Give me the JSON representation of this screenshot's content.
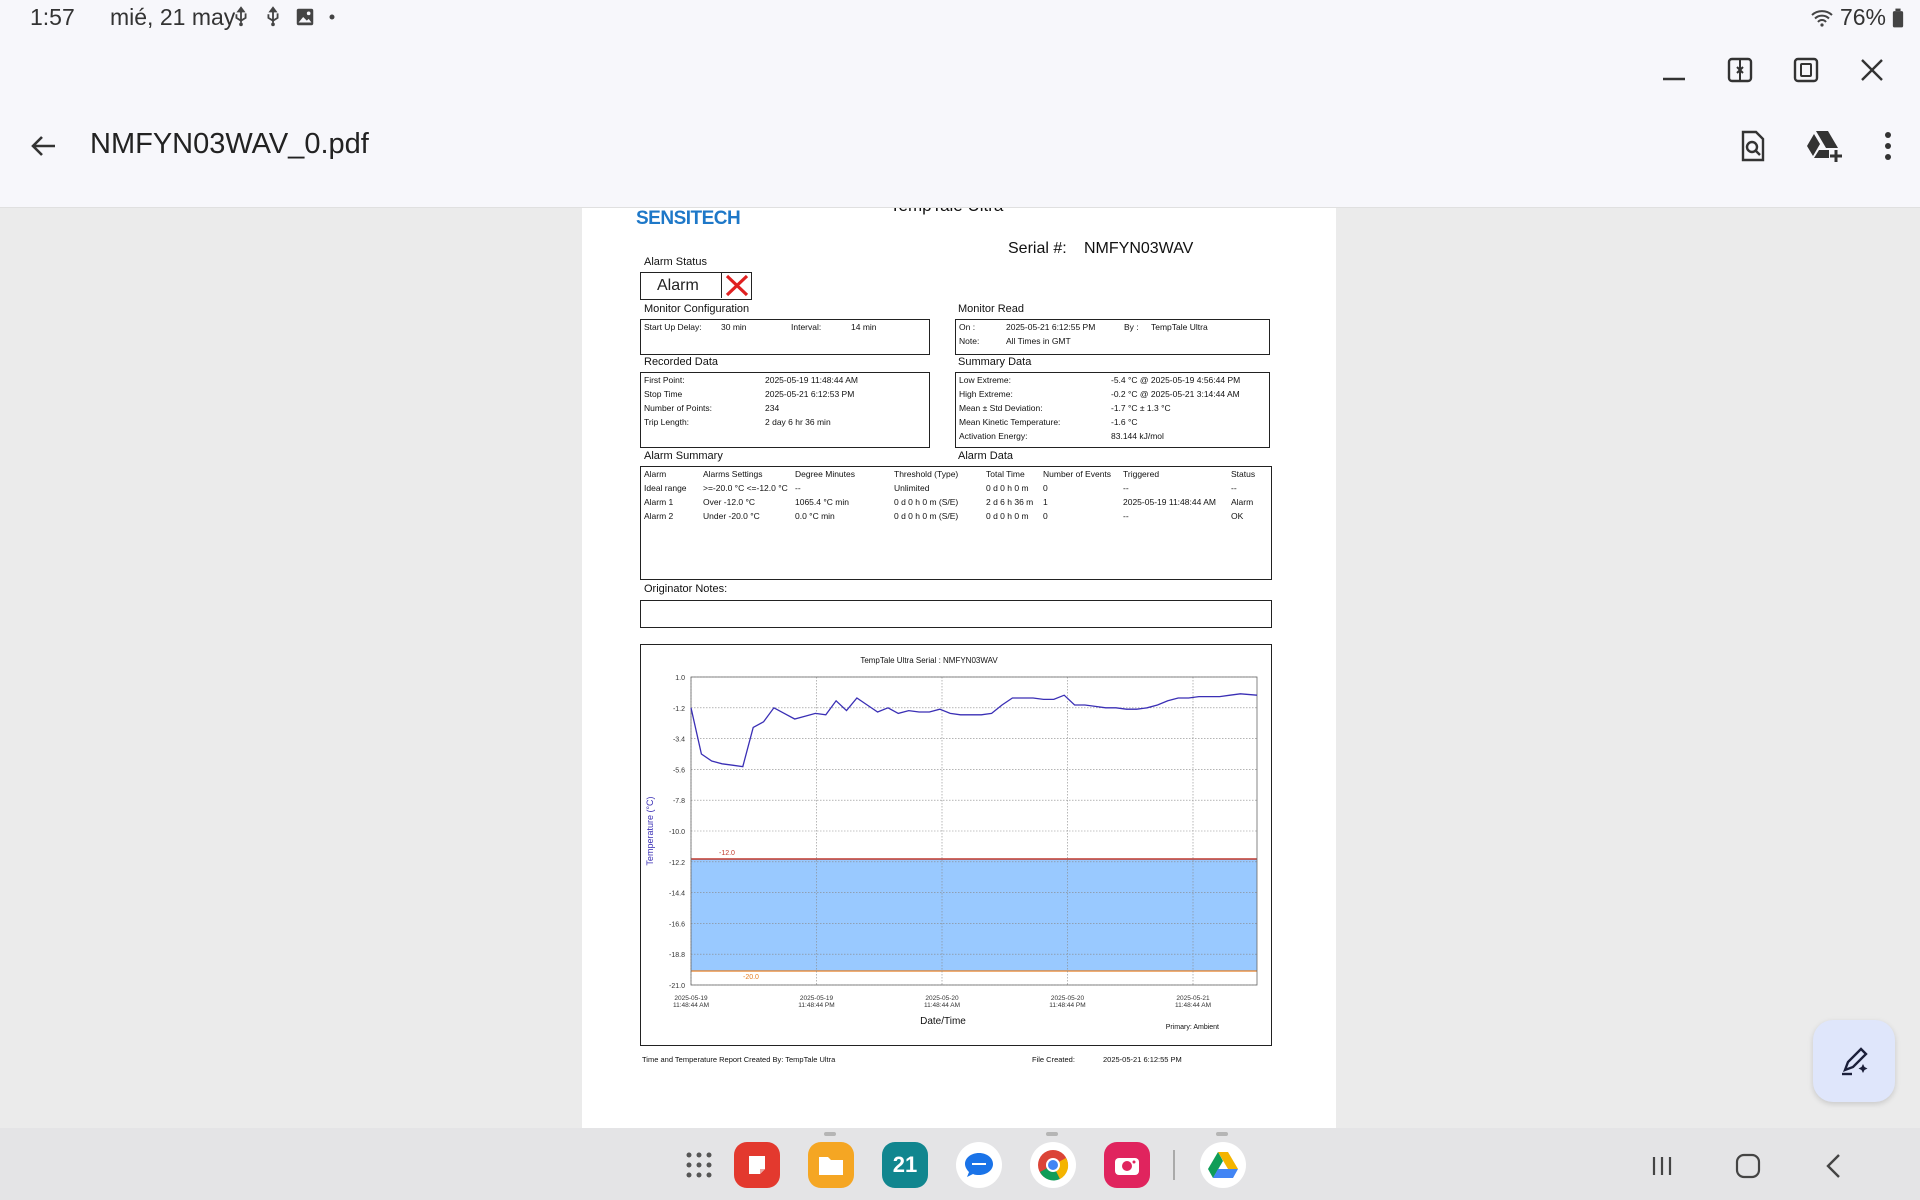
{
  "status_bar": {
    "time": "1:57",
    "date": "mié, 21 may",
    "battery": "76%"
  },
  "app_bar": {
    "title": "NMFYN03WAV_0.pdf"
  },
  "report": {
    "logo": "SENSITECH",
    "product": "TempTale Ultra",
    "serial_label": "Serial #:",
    "serial": "NMFYN03WAV",
    "alarm_status_label": "Alarm Status",
    "alarm_status": "Alarm",
    "monitor_config": {
      "title": "Monitor Configuration",
      "startup_label": "Start Up Delay:",
      "startup": "30 min",
      "interval_label": "Interval:",
      "interval": "14 min"
    },
    "monitor_read": {
      "title": "Monitor Read",
      "on_label": "On :",
      "on": "2025-05-21  6:12:55 PM",
      "by_label": "By :",
      "by": "TempTale Ultra",
      "note_label": "Note:",
      "note": "All Times in GMT"
    },
    "recorded": {
      "title": "Recorded Data",
      "rows": [
        {
          "k": "First Point:",
          "v": "2025-05-19 11:48:44 AM"
        },
        {
          "k": "Stop Time",
          "v": "2025-05-21  6:12:53 PM"
        },
        {
          "k": "Number of Points:",
          "v": "234"
        },
        {
          "k": "Trip Length:",
          "v": "2 day 6 hr 36 min"
        }
      ]
    },
    "summary": {
      "title": "Summary Data",
      "rows": [
        {
          "k": "Low Extreme:",
          "v": "-5.4 °C @ 2025-05-19  4:56:44 PM"
        },
        {
          "k": "High Extreme:",
          "v": "-0.2 °C @ 2025-05-21  3:14:44 AM"
        },
        {
          "k": "Mean ± Std Deviation:",
          "v": "-1.7 °C ± 1.3 °C"
        },
        {
          "k": "Mean Kinetic Temperature:",
          "v": "-1.6 °C"
        },
        {
          "k": "Activation Energy:",
          "v": "83.144 kJ/mol"
        }
      ]
    },
    "alarm_summary_title": "Alarm Summary",
    "alarm_data_title": "Alarm Data",
    "alarm_headers": [
      "Alarm",
      "Alarms Settings",
      "Degree Minutes",
      "Threshold (Type)",
      "Total Time",
      "Number of Events",
      "Triggered",
      "Status"
    ],
    "alarm_rows": [
      [
        "Ideal range",
        ">=-20.0 °C <=-12.0 °C",
        "--",
        "Unlimited",
        "0 d 0 h 0 m",
        "0",
        "--",
        "--"
      ],
      [
        "Alarm 1",
        "Over -12.0 °C",
        "1065.4 °C min",
        "0 d 0 h 0 m (S/E)",
        "2 d 6 h 36 m",
        "1",
        "2025-05-19 11:48:44 AM",
        "Alarm"
      ],
      [
        "Alarm 2",
        "Under -20.0 °C",
        "0.0 °C min",
        "0 d 0 h 0 m (S/E)",
        "0 d 0 h 0 m",
        "0",
        "--",
        "OK"
      ]
    ],
    "originator_label": "Originator Notes:",
    "footer_left": "Time and Temperature Report Created By:  TempTale Ultra",
    "footer_file_label": "File Created:",
    "footer_file": "2025-05-21  6:12:55 PM"
  },
  "chart_data": {
    "type": "line",
    "title": "TempTale Ultra  Serial : NMFYN03WAV",
    "xlabel": "Date/Time",
    "ylabel": "Temperature (°C)",
    "legend_note": "Primary: Ambient",
    "ylim": [
      -21.0,
      1.0
    ],
    "y_ticks": [
      "1.0",
      "-1.2",
      "-3.4",
      "-5.6",
      "-7.8",
      "-10.0",
      "-12.2",
      "-14.4",
      "-16.6",
      "-18.8",
      "-21.0"
    ],
    "x_ticks": [
      [
        "2025-05-19",
        "11:48:44 AM"
      ],
      [
        "2025-05-19",
        "11:48:44 PM"
      ],
      [
        "2025-05-20",
        "11:48:44 AM"
      ],
      [
        "2025-05-20",
        "11:48:44 PM"
      ],
      [
        "2025-05-21",
        "11:48:44 AM"
      ]
    ],
    "band": {
      "low": -20.0,
      "high": -12.0,
      "low_label": "-20.0",
      "high_label": "-12.0",
      "color": "#99c9ff"
    },
    "series": [
      {
        "color": "#3a2fb5",
        "x": [
          0,
          1,
          2,
          3,
          4,
          5,
          6,
          7,
          8,
          9,
          10,
          11,
          12,
          13,
          14,
          15,
          16,
          17,
          18,
          19,
          20,
          21,
          22,
          23,
          24,
          25,
          26,
          27,
          28,
          29,
          30,
          31,
          32,
          33,
          34,
          35,
          36,
          37,
          38,
          39,
          40,
          41,
          42,
          43,
          44,
          45,
          46,
          47,
          48,
          49,
          50,
          51,
          52,
          53,
          54.6
        ],
        "y": [
          -1.2,
          -4.5,
          -5.0,
          -5.2,
          -5.3,
          -5.4,
          -2.6,
          -2.2,
          -1.2,
          -1.6,
          -2.0,
          -1.8,
          -1.6,
          -1.7,
          -0.7,
          -1.4,
          -0.5,
          -1.0,
          -1.5,
          -1.2,
          -1.6,
          -1.4,
          -1.5,
          -1.5,
          -1.3,
          -1.6,
          -1.7,
          -1.7,
          -1.7,
          -1.6,
          -1.0,
          -0.5,
          -0.5,
          -0.5,
          -0.6,
          -0.6,
          -0.3,
          -1.0,
          -1.0,
          -1.1,
          -1.2,
          -1.2,
          -1.3,
          -1.3,
          -1.2,
          -1.0,
          -0.7,
          -0.5,
          -0.5,
          -0.4,
          -0.4,
          -0.4,
          -0.3,
          -0.2,
          -0.3
        ]
      }
    ]
  }
}
